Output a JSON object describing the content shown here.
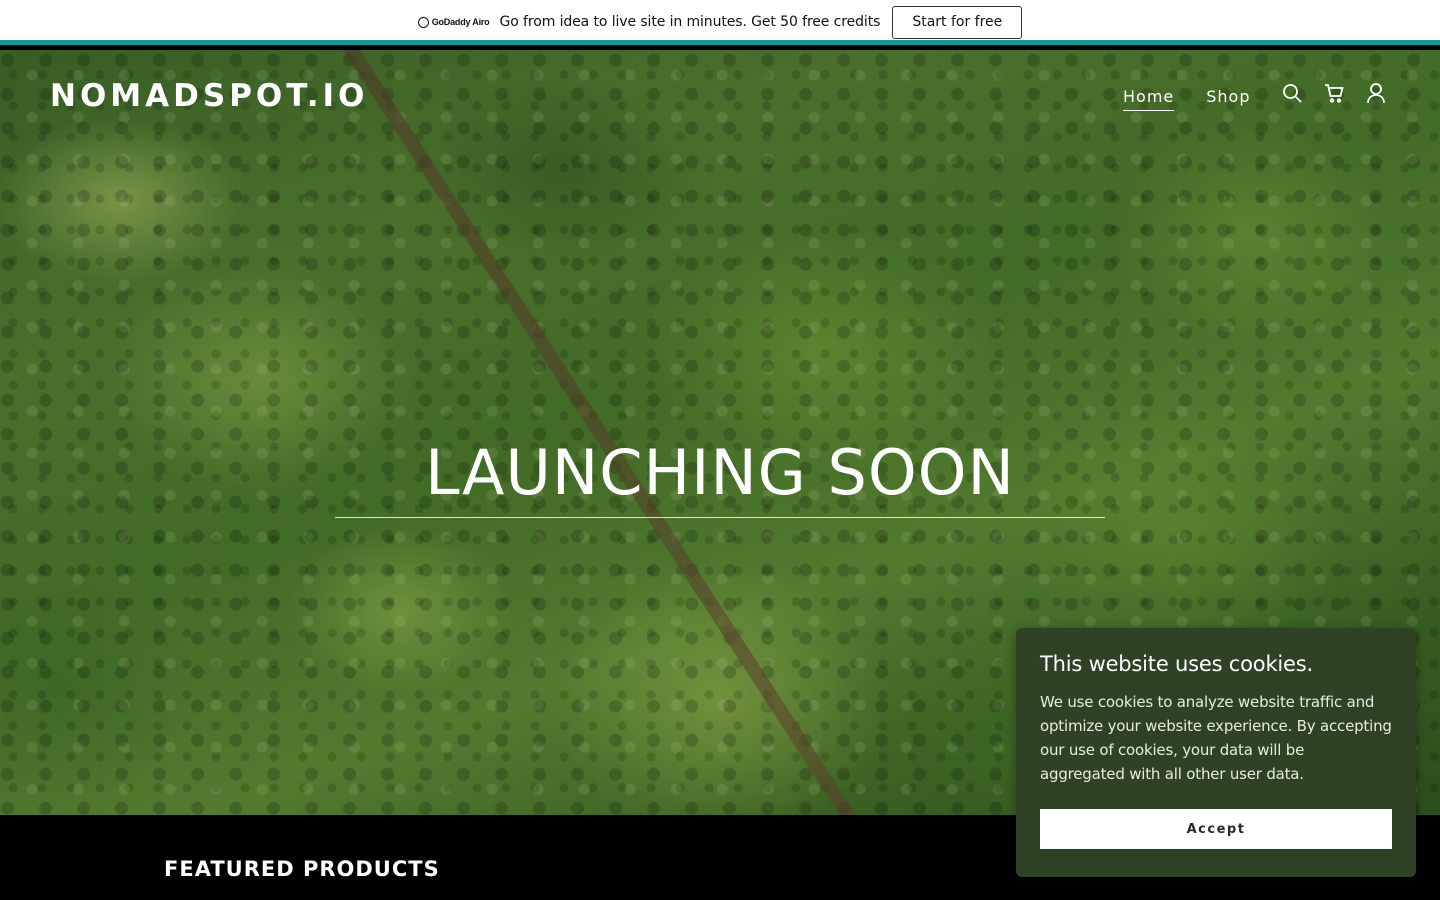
{
  "promo": {
    "brand": "GoDaddy Airo",
    "text": "Go from idea to live site in minutes. Get 50 free credits",
    "button_label": "Start for free",
    "accent_color": "#0e9a9a"
  },
  "header": {
    "site_name": "NOMADSPOT.IO",
    "nav": [
      {
        "label": "Home",
        "active": true
      },
      {
        "label": "Shop",
        "active": false
      }
    ],
    "icons": [
      "search-icon",
      "cart-icon",
      "account-icon"
    ]
  },
  "hero": {
    "title": "LAUNCHING SOON"
  },
  "featured": {
    "heading": "FEATURED PRODUCTS"
  },
  "cookie": {
    "title": "This website uses cookies.",
    "body": "We use cookies to analyze website traffic and optimize your website experience. By accepting our use of cookies, your data will be aggregated with all other user data.",
    "accept_label": "Accept",
    "background_color": "#2f4226"
  }
}
